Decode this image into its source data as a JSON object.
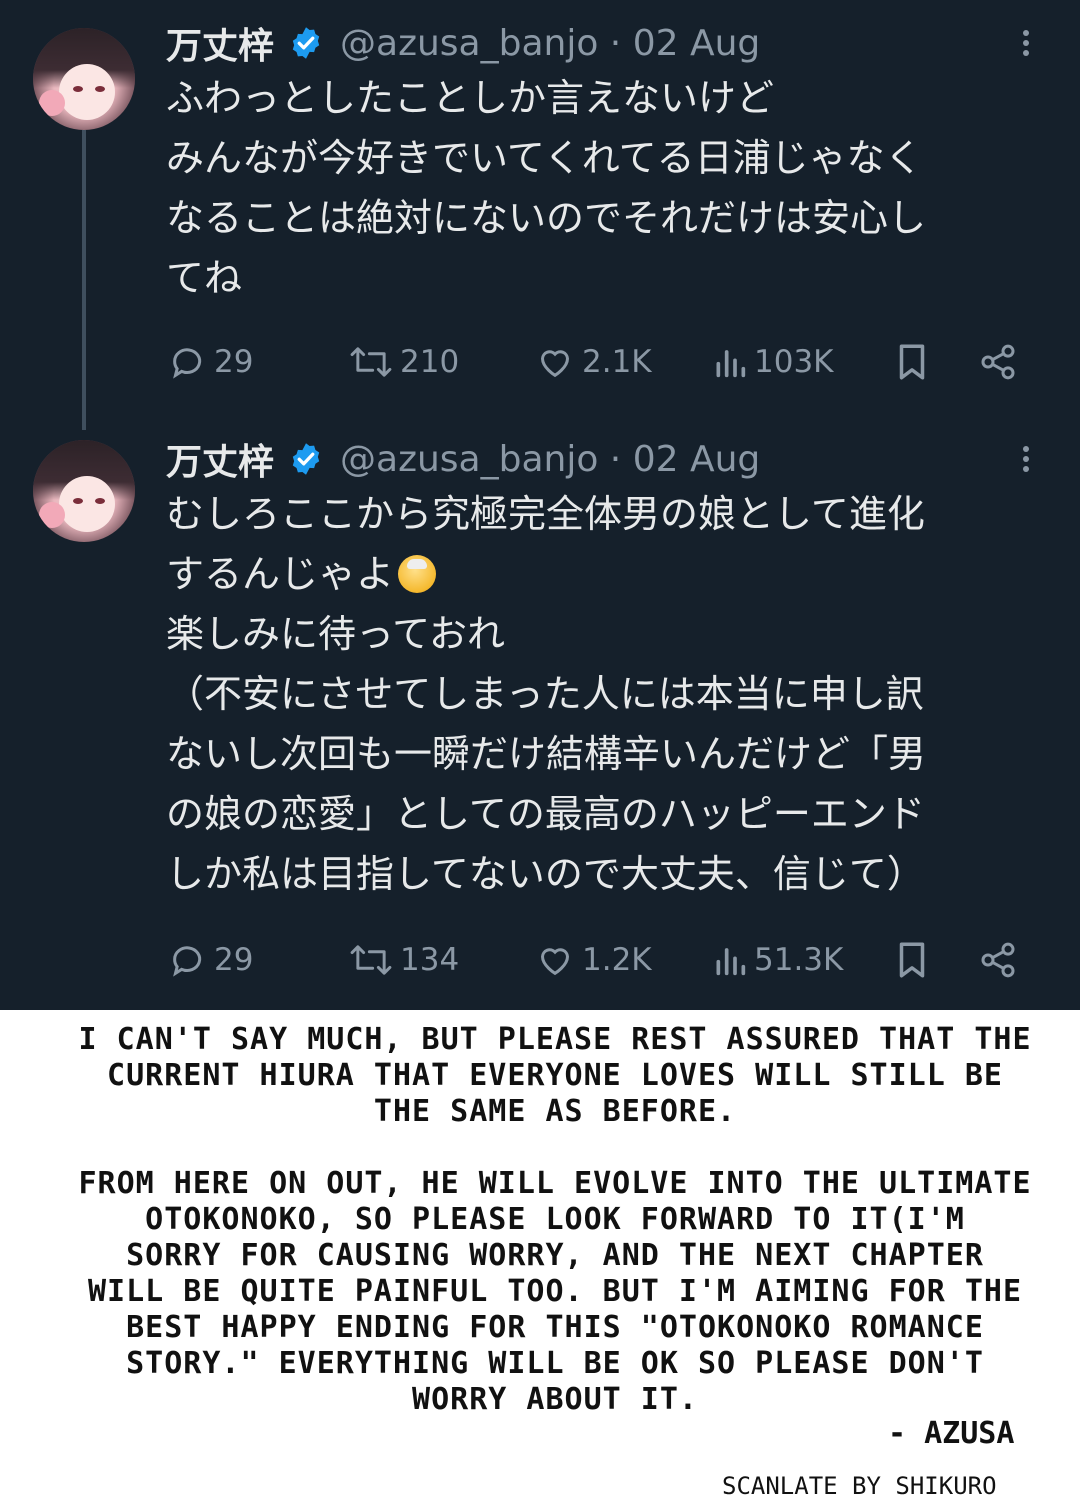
{
  "colors": {
    "background": "#15202b",
    "text": "#e7e9ea",
    "muted": "#8b98a5",
    "verified": "#1d9bf0",
    "caption": "#111111"
  },
  "tweets": [
    {
      "name": "万丈梓",
      "handle": "@azusa_banjo · 02 Aug",
      "lines": [
        "ふわっとしたことしか言えないけど",
        "みんなが今好きでいてくれてる日浦じゃなく",
        "なることは絶対にないのでそれだけは安心し",
        "てね"
      ],
      "replies": "29",
      "retweets": "210",
      "likes": "2.1K",
      "views": "103K"
    },
    {
      "name": "万丈梓",
      "handle": "@azusa_banjo · 02 Aug",
      "lines": [
        "むしろここから究極完全体男の娘として進化",
        "するんじゃよ",
        "楽しみに待っておれ",
        "（不安にさせてしまった人には本当に申し訳",
        "ないし次回も一瞬だけ結構辛いんだけど「男",
        "の娘の恋愛」としての最高のハッピーエンド",
        "しか私は目指してないので大丈夫、信じて）"
      ],
      "emoji": "older-man-emoji",
      "replies": "29",
      "retweets": "134",
      "likes": "1.2K",
      "views": "51.3K"
    }
  ],
  "translation": {
    "paragraph1": [
      "I can't say much, but please rest assured that the",
      "current Hiura that everyone loves will still be",
      "the same as before."
    ],
    "paragraph2": [
      "From here on out, he will evolve into the ultimate",
      "otokonoko, so please look forward to it(I'm",
      "sorry for causing worry, and the next chapter",
      "will be quite painful too. But I'm aiming for the",
      "best happy ending for this \"otokonoko romance",
      "story.\" Everything will be ok so please don't",
      "worry about it."
    ],
    "signature": "- Azusa",
    "credit": "Scanlate by Shikuro"
  }
}
